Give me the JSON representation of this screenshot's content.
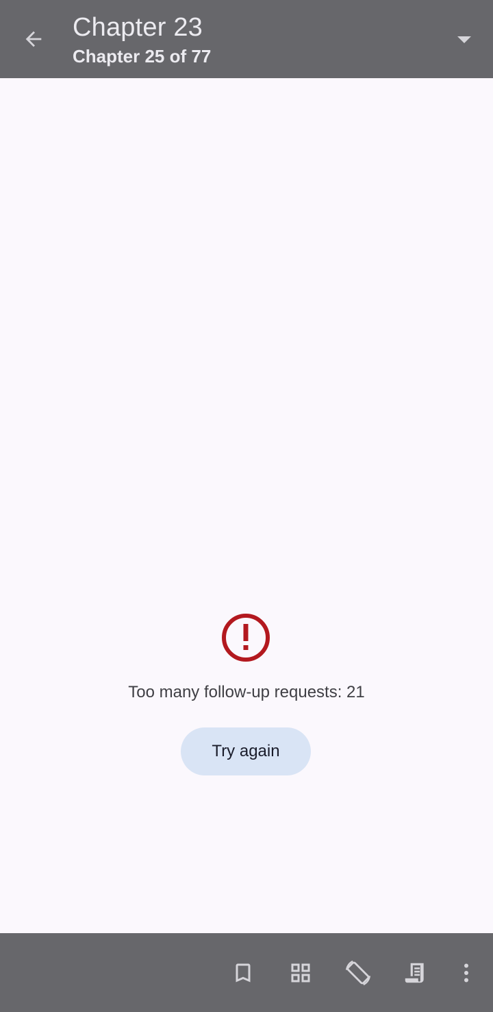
{
  "header": {
    "title": "Chapter 23",
    "subtitle": "Chapter 25 of 77",
    "back_icon": "arrow-back-icon",
    "dropdown_icon": "dropdown-arrow-icon"
  },
  "error": {
    "icon": "error-outline-icon",
    "message": "Too many follow-up requests: 21",
    "retry_label": "Try again"
  },
  "bottom_bar": {
    "items": [
      {
        "icon": "bookmark-icon"
      },
      {
        "icon": "grid-icon"
      },
      {
        "icon": "screen-rotation-icon"
      },
      {
        "icon": "reading-mode-icon"
      },
      {
        "icon": "more-vert-icon"
      }
    ]
  },
  "colors": {
    "bar_background": "#67676b",
    "page_background": "#fbf8fd",
    "error_red": "#b3191f",
    "button_background": "#d9e4f5"
  }
}
